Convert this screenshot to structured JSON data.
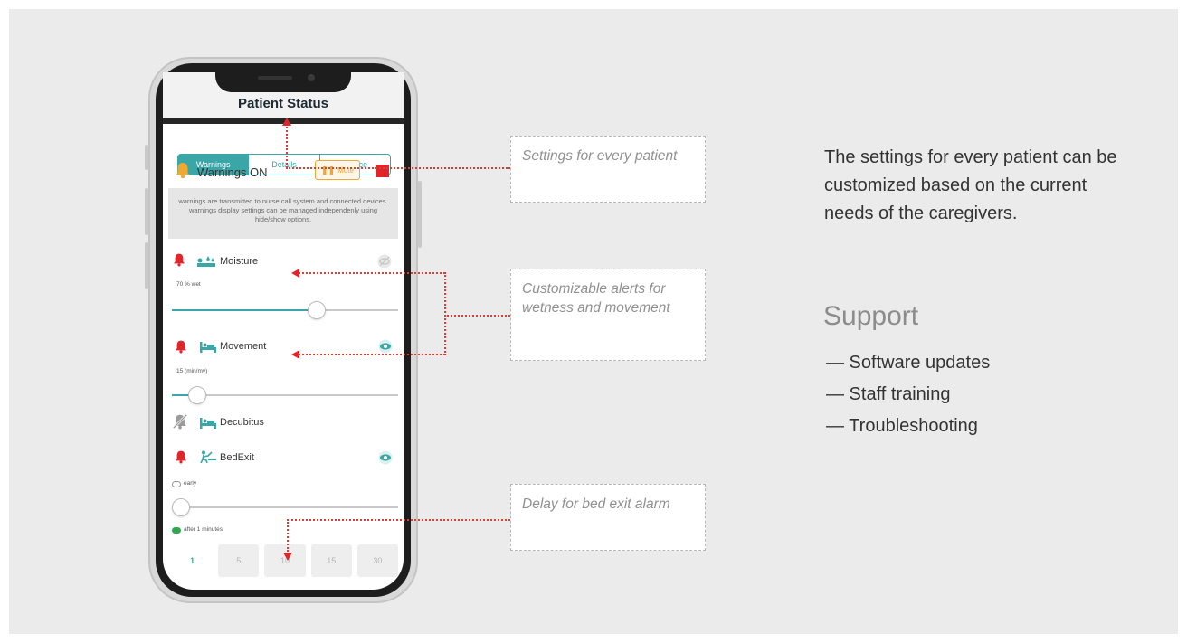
{
  "app": {
    "title": "Patient Status",
    "tabs": [
      {
        "label": "Warnings",
        "active": true
      },
      {
        "label": "Details",
        "active": false
      },
      {
        "label": "Device",
        "active": false
      }
    ],
    "warnings": {
      "label": "Warnings ON",
      "mute_label": "Mute",
      "info": "warnings are transmitted to nurse call system and connected devices. warnings display settings can be managed independenly using hide/show options."
    },
    "alerts": [
      {
        "name": "Moisture",
        "value_label": "70 % wet",
        "slider_fraction": 0.65
      },
      {
        "name": "Movement",
        "value_label": "15 (min/mv)",
        "slider_fraction": 0.08
      },
      {
        "name": "Decubitus"
      },
      {
        "name": "BedExit",
        "toggle_label": "early",
        "slider_fraction": 0.0,
        "delay_label": "after 1 minutes"
      }
    ],
    "delay_options": [
      "1",
      "5",
      "10",
      "15",
      "30"
    ],
    "delay_selected": "1"
  },
  "callouts": {
    "settings": "Settings for every patient",
    "alerts": "Customizable alerts for wetness and movement",
    "delay": "Delay for bed exit alarm"
  },
  "description": "The settings for every patient can be customized based on the current needs of the caregivers.",
  "support": {
    "title": "Support",
    "items": [
      "— Software updates",
      "— Staff training",
      "— Troubleshooting"
    ]
  },
  "colors": {
    "accent": "#3aa6a8",
    "alarm": "#e0262b",
    "warning": "#f0a830",
    "panel": "#ebebeb"
  },
  "icons": [
    "bell-icon",
    "bell-muted-icon",
    "eye-icon",
    "eye-off-icon",
    "moisture-icon",
    "bed-icon",
    "bed-exit-icon",
    "pause-icon",
    "stop-icon"
  ]
}
